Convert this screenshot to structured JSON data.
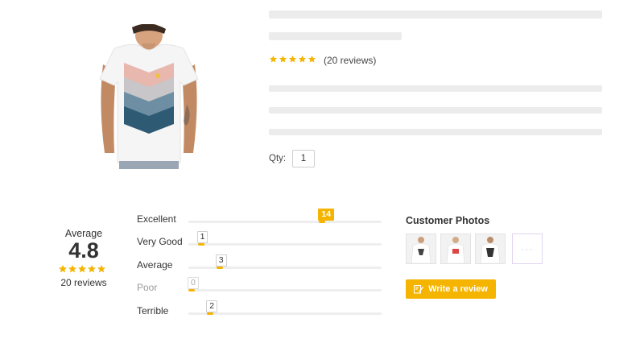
{
  "product": {
    "image_icon": "tshirt-photo",
    "rating": 5,
    "reviews_link": "(20 reviews)",
    "qty_label": "Qty:",
    "qty_value": "1"
  },
  "summary": {
    "label": "Average",
    "value": "4.8",
    "stars": 5,
    "total": "20 reviews"
  },
  "distribution": [
    {
      "label": "Excellent",
      "count": "14",
      "fraction": 0.7,
      "active": true
    },
    {
      "label": "Very Good",
      "count": "1",
      "fraction": 0.05,
      "active": false
    },
    {
      "label": "Average",
      "count": "3",
      "fraction": 0.15,
      "active": false
    },
    {
      "label": "Poor",
      "count": "0",
      "fraction": 0.0,
      "active": false,
      "muted": true
    },
    {
      "label": "Terrible",
      "count": "2",
      "fraction": 0.1,
      "active": false
    }
  ],
  "photos": {
    "title": "Customer Photos",
    "more": "···",
    "write_label": "Write a review"
  },
  "colors": {
    "accent": "#f5b400",
    "skeleton": "#ececec"
  }
}
